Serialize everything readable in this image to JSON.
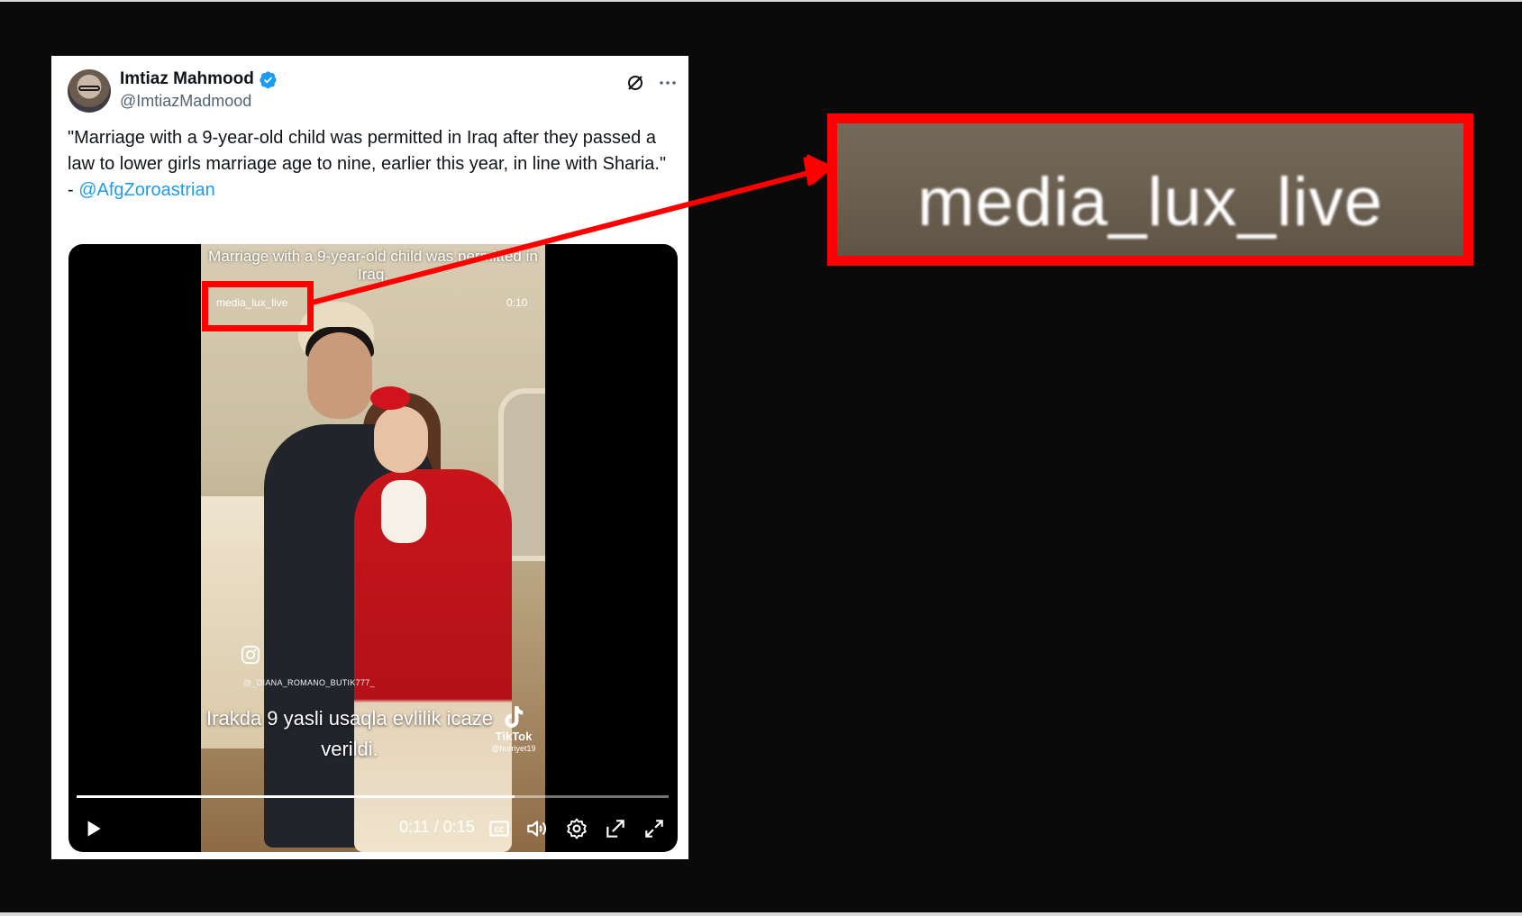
{
  "tweet": {
    "author_name": "Imtiaz Mahmood",
    "author_handle": "@ImtiazMadmood",
    "text_line": "\"Marriage with a 9-year-old child was permitted in Iraq after they passed a law to lower girls marriage age to nine, earlier this year, in line with Sharia.\"",
    "credit_prefix": "- ",
    "credit_mention": "@AfgZoroastrian"
  },
  "video": {
    "caption": "Marriage with a 9-year-old child was permitted in Iraq.",
    "watermark": "media_lux_live",
    "time_top": "0:10",
    "ig_handle": "@_DIANA_ROMANO_BUTIK777_",
    "subtitle": "Irakda 9 yasli usaqla evlilik icaze verildi.",
    "tiktok_name": "TikTok",
    "tiktok_handle": "@hurriyet19",
    "time_display": "0:11 / 0:15",
    "progress_fraction": 0.74
  },
  "zoom": {
    "text": "media_lux_live"
  },
  "colors": {
    "highlight": "#ff0000",
    "mention": "#1d9bf0",
    "verified": "#1d9bf0"
  },
  "icons": [
    "verified-icon",
    "grok-icon",
    "more-icon",
    "instagram-icon",
    "tiktok-icon",
    "play-icon",
    "captions-icon",
    "volume-icon",
    "settings-icon",
    "pip-icon",
    "fullscreen-icon"
  ]
}
